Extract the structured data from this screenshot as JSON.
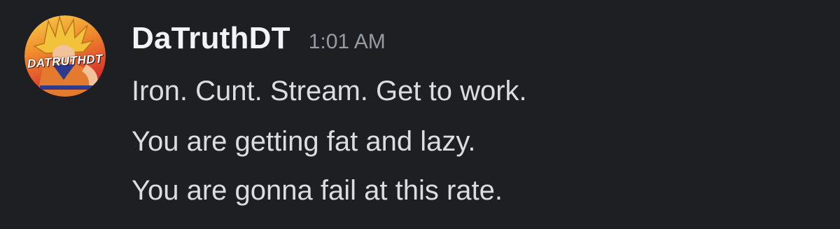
{
  "message": {
    "author": "DaTruthDT",
    "timestamp": "1:01 AM",
    "avatar_text": "DATRUTHDT",
    "lines": [
      "Iron. Cunt. Stream. Get to work.",
      "You are getting fat and lazy.",
      "You are gonna fail at this rate."
    ]
  },
  "colors": {
    "background": "#1e1f22",
    "username": "#f2f3f5",
    "timestamp": "#949ba4",
    "message_text": "#dbdee1",
    "avatar_gradient_top": "#f3b92f",
    "avatar_gradient_bottom": "#d62f2a"
  }
}
